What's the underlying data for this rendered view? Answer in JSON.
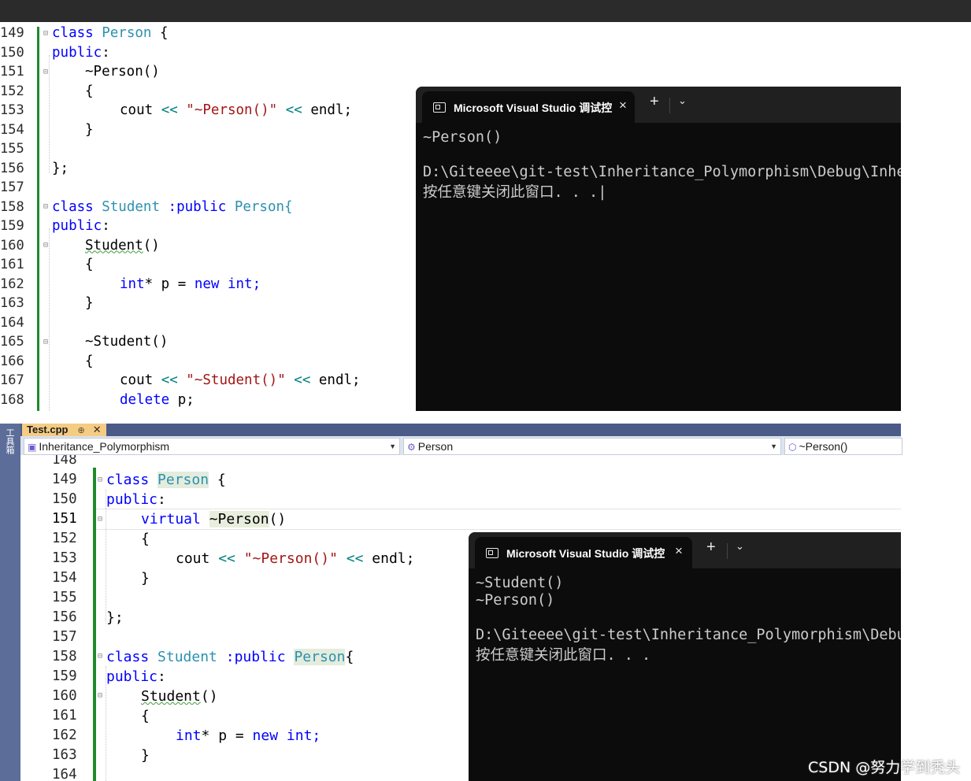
{
  "editor1": {
    "lines": [
      {
        "num": "149",
        "code": ""
      },
      {
        "num": "150",
        "code": ""
      },
      {
        "num": "151",
        "code": ""
      },
      {
        "num": "152",
        "code": ""
      },
      {
        "num": "153",
        "code": ""
      },
      {
        "num": "154",
        "code": ""
      },
      {
        "num": "155",
        "code": ""
      },
      {
        "num": "156",
        "code": ""
      },
      {
        "num": "157",
        "code": ""
      },
      {
        "num": "158",
        "code": ""
      },
      {
        "num": "159",
        "code": ""
      },
      {
        "num": "160",
        "code": ""
      },
      {
        "num": "161",
        "code": ""
      },
      {
        "num": "162",
        "code": ""
      },
      {
        "num": "163",
        "code": ""
      },
      {
        "num": "164",
        "code": ""
      },
      {
        "num": "165",
        "code": ""
      },
      {
        "num": "166",
        "code": ""
      },
      {
        "num": "167",
        "code": ""
      },
      {
        "num": "168",
        "code": ""
      }
    ],
    "tokens": {
      "class": "class",
      "person": "Person",
      "brace_open": " {",
      "public": "public",
      "colon": ":",
      "dtor_person": "~Person()",
      "lbrace": "{",
      "cout": "cout ",
      "shl": "<<",
      "str_person": " \"~Person()\" ",
      "endl": " endl;",
      "rbrace": "}",
      "close_class": "};",
      "student": "Student",
      "inherit": " :public ",
      "person_brace": "Person{",
      "student_ctor": "Student",
      "parens": "()",
      "int_ptr": "int",
      "star_p": "* p = ",
      "new": "new",
      "int_end": " int;",
      "dtor_student": "~Student()",
      "str_student": " \"~Student()\" ",
      "delete": "delete",
      "delete_p": " p;"
    }
  },
  "console1": {
    "tab_title": "Microsoft Visual Studio 调试控",
    "close_glyph": "×",
    "plus_glyph": "+",
    "chevron_glyph": "⌄",
    "output": [
      "~Person()",
      "",
      "D:\\Giteeee\\git-test\\Inheritance_Polymorphism\\Debug\\Inher",
      "按任意键关闭此窗口. . .|"
    ]
  },
  "vs": {
    "side_label": "工具箱",
    "file_tab": "Test.cpp",
    "file_tab_pin": "⊕",
    "file_tab_close": "✕",
    "nav_project": "Inheritance_Polymorphism",
    "nav_class": "Person",
    "nav_member": "~Person()"
  },
  "editor2": {
    "line_numbers": [
      "148",
      "149",
      "150",
      "151",
      "152",
      "153",
      "154",
      "155",
      "156",
      "157",
      "158",
      "159",
      "160",
      "161",
      "162",
      "163",
      "164"
    ],
    "current_line": "151",
    "tokens": {
      "class": "class",
      "person": "Person",
      "brace_open": " {",
      "public": "public",
      "colon": ":",
      "virtual": "virtual",
      "dtor_person": "~Person",
      "parens": "()",
      "lbrace": "{",
      "cout": "cout ",
      "shl": "<<",
      "str_person": " \"~Person()\" ",
      "endl": " endl;",
      "rbrace": "}",
      "close_class": "};",
      "student": "Student",
      "inherit": " :public ",
      "person2": "Person",
      "brace_open2": "{",
      "student_ctor": "Student",
      "int_ptr": "int",
      "star_p": "* p = ",
      "new": "new",
      "int_end": " int;"
    }
  },
  "console2": {
    "tab_title": "Microsoft Visual Studio 调试控",
    "close_glyph": "×",
    "plus_glyph": "+",
    "chevron_glyph": "⌄",
    "output": [
      "~Student()",
      "~Person()",
      "",
      "D:\\Giteeee\\git-test\\Inheritance_Polymorphism\\Debu",
      "按任意键关闭此窗口. . ."
    ]
  },
  "watermark": "CSDN @努力学到秃头"
}
